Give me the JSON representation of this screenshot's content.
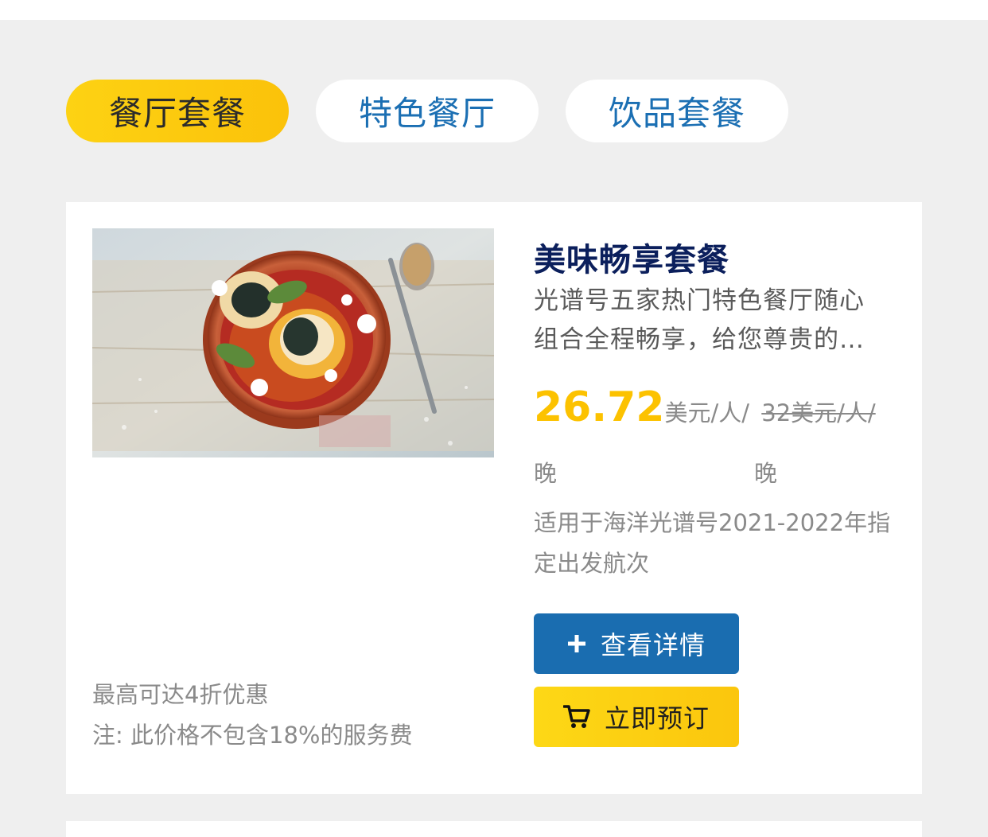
{
  "tabs": [
    {
      "label": "餐厅套餐",
      "active": true
    },
    {
      "label": "特色餐厅",
      "active": false
    },
    {
      "label": "饮品套餐",
      "active": false
    }
  ],
  "offer": {
    "image_alt": "food-photo",
    "title": "美味畅享套餐",
    "description": "光谱号五家热门特色餐厅随心组合全程畅享，给您尊贵的餐饮体验",
    "price": "26.72",
    "price_unit": "美元/人/",
    "original_price": "32美元/人/",
    "per_night_1": "晚",
    "per_night_2": "晚",
    "applicability": "适用于海洋光谱号2021-2022年指定出发航次",
    "detail_button": "查看详情",
    "book_button": "立即预订",
    "discount_note": "最高可达4折优惠",
    "service_note": "注: 此价格不包含18%的服务费"
  },
  "colors": {
    "accent_yellow": "#fcc200",
    "primary_blue": "#1a6db0",
    "title_navy": "#0b1f5c",
    "background": "#efefef"
  },
  "icons": {
    "detail": "plus-icon",
    "book": "cart-icon"
  }
}
